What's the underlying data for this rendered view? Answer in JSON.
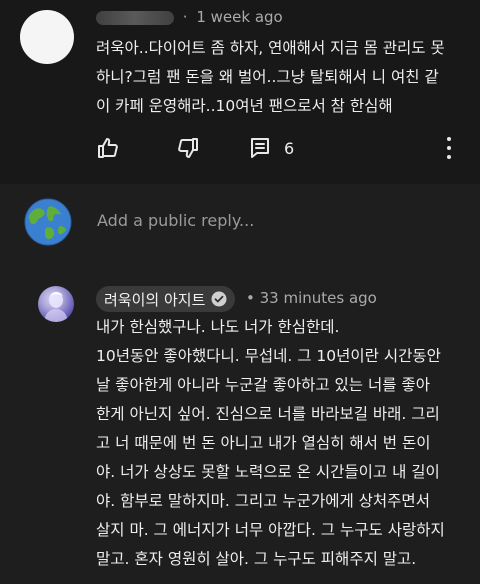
{
  "comment": {
    "time": "1 week ago",
    "text_lines": [
      "려욱아..다이어트 좀 하자, 연애해서 지금 몸 관리도 못",
      "하니?그럼 팬 돈을 왜 벌어..그냥 탈퇴해서 니 여친 같",
      "이 카페 운영해라..10여년 팬으로서 참 한심해"
    ],
    "reply_count": "6"
  },
  "reply_box": {
    "placeholder": "Add a public reply..."
  },
  "reply": {
    "author": "려욱이의 아지트",
    "time": "• 33 minutes ago",
    "text_lines": [
      "내가 한심했구나. 나도 너가 한심한데.",
      "10년동안 좋아했다니. 무섭네. 그 10년이란 시간동안",
      "날 좋아한게 아니라 누군갈 좋아하고 있는 너를 좋아",
      "한게 아닌지 싶어. 진심으로 너를 바라보길 바래. 그리",
      "고 너 때문에 번 돈 아니고 내가 열심히 해서 번 돈이",
      "야. 너가 상상도 못할 노력으로 온 시간들이고 내 길이",
      "야. 함부로 말하지마. 그리고 누군가에게 상처주면서",
      "살지 마. 그 에너지가 너무 아깝다. 그 누구도 사랑하지",
      "말고. 혼자 영원히 살아. 그 누구도 피해주지 말고."
    ]
  },
  "icons": [
    "like-icon",
    "dislike-icon",
    "reply-icon",
    "more-vert-icon",
    "globe-icon",
    "verified-check-icon"
  ],
  "colors": {
    "background": "#181818",
    "secondary_text": "#aaaaaa",
    "author_pill": "#3a3a3a"
  }
}
